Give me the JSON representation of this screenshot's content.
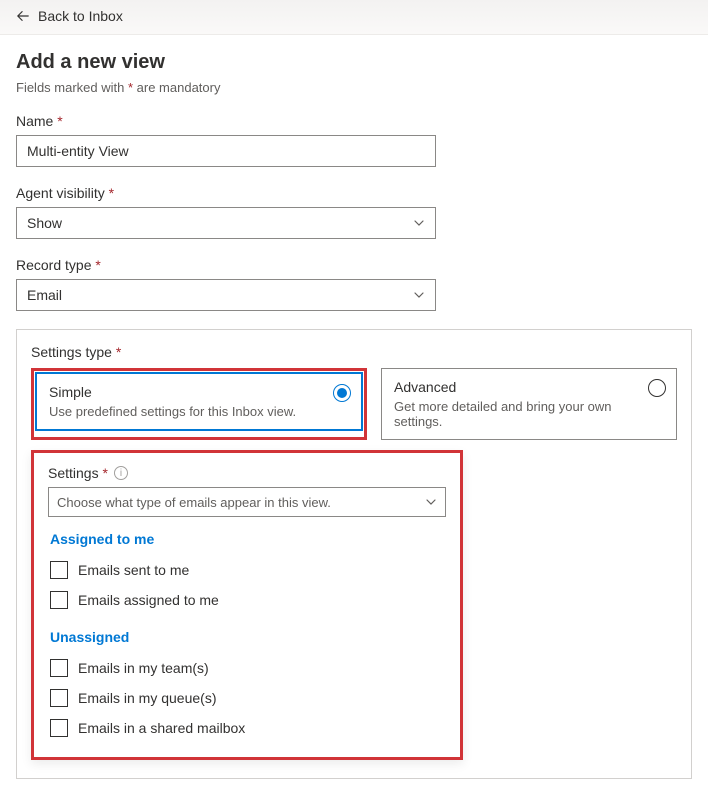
{
  "topbar": {
    "back_label": "Back to Inbox"
  },
  "page": {
    "title": "Add a new view",
    "mandatory_hint_prefix": "Fields marked with ",
    "mandatory_hint_suffix": " are mandatory",
    "asterisk": "*"
  },
  "fields": {
    "name": {
      "label": "Name",
      "value": "Multi-entity View"
    },
    "agent_visibility": {
      "label": "Agent visibility",
      "value": "Show"
    },
    "record_type": {
      "label": "Record type",
      "value": "Email"
    }
  },
  "settings_type": {
    "label": "Settings type",
    "simple": {
      "title": "Simple",
      "desc": "Use predefined settings for this Inbox view."
    },
    "advanced": {
      "title": "Advanced",
      "desc": "Get more detailed and bring your own settings."
    }
  },
  "settings": {
    "label": "Settings",
    "placeholder": "Choose what type of emails appear in this view.",
    "groups": [
      {
        "title": "Assigned to me",
        "options": [
          "Emails sent to me",
          "Emails assigned to me"
        ]
      },
      {
        "title": "Unassigned",
        "options": [
          "Emails in my team(s)",
          "Emails in my queue(s)",
          "Emails in a shared mailbox"
        ]
      }
    ]
  }
}
